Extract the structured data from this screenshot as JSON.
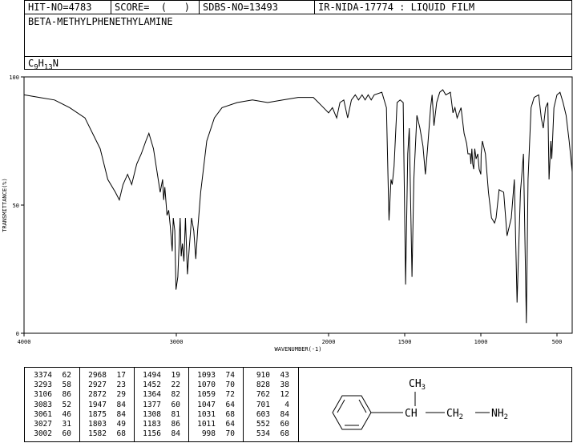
{
  "header": {
    "hit_no": "HIT-NO=4783",
    "score": "SCORE=  (   )",
    "sdbs_no": "SDBS-NO=13493",
    "ir_method": "IR-NIDA-17774 : LIQUID FILM",
    "compound_name": "BETA-METHYLPHENETHYLAMINE",
    "formula": {
      "c": "C",
      "c_n": "9",
      "h": "H",
      "h_n": "13",
      "n": "N"
    }
  },
  "chart_data": {
    "type": "line",
    "xlabel": "WAVENUMBER(-1)",
    "ylabel": "TRANSMITTANCE(%)",
    "xlim": [
      4000,
      400
    ],
    "ylim": [
      0,
      100
    ],
    "x_ticks": [
      4000,
      3000,
      2000,
      1500,
      1000,
      500
    ],
    "y_ticks": [
      100,
      50,
      0
    ],
    "grid": false,
    "x": [
      4000,
      3900,
      3800,
      3700,
      3600,
      3500,
      3450,
      3400,
      3374,
      3350,
      3320,
      3293,
      3260,
      3230,
      3200,
      3180,
      3150,
      3106,
      3090,
      3083,
      3075,
      3061,
      3050,
      3040,
      3027,
      3020,
      3010,
      3002,
      2990,
      2975,
      2968,
      2960,
      2950,
      2940,
      2927,
      2915,
      2900,
      2885,
      2872,
      2860,
      2840,
      2800,
      2750,
      2700,
      2600,
      2500,
      2400,
      2300,
      2200,
      2100,
      2050,
      2000,
      1975,
      1947,
      1925,
      1900,
      1875,
      1850,
      1825,
      1803,
      1780,
      1760,
      1740,
      1720,
      1700,
      1650,
      1620,
      1603,
      1590,
      1582,
      1570,
      1550,
      1530,
      1510,
      1494,
      1480,
      1470,
      1452,
      1440,
      1420,
      1400,
      1380,
      1364,
      1350,
      1330,
      1320,
      1308,
      1290,
      1270,
      1250,
      1230,
      1200,
      1183,
      1170,
      1156,
      1130,
      1110,
      1093,
      1085,
      1070,
      1065,
      1059,
      1053,
      1047,
      1040,
      1031,
      1020,
      1011,
      1000,
      998,
      990,
      970,
      950,
      930,
      910,
      900,
      880,
      850,
      828,
      800,
      780,
      762,
      740,
      720,
      701,
      690,
      670,
      650,
      620,
      603,
      590,
      575,
      560,
      552,
      540,
      534,
      520,
      500,
      480,
      460,
      440,
      420,
      400
    ],
    "y": [
      93,
      92,
      91,
      88,
      84,
      72,
      60,
      55,
      52,
      58,
      62,
      58,
      66,
      70,
      75,
      78,
      72,
      55,
      60,
      52,
      57,
      46,
      48,
      42,
      32,
      45,
      40,
      17,
      22,
      45,
      30,
      35,
      28,
      45,
      23,
      33,
      45,
      40,
      29,
      40,
      55,
      75,
      84,
      88,
      90,
      91,
      90,
      91,
      92,
      92,
      89,
      86,
      88,
      84,
      90,
      91,
      84,
      91,
      93,
      91,
      93,
      91,
      93,
      91,
      93,
      94,
      88,
      44,
      60,
      58,
      65,
      90,
      91,
      90,
      19,
      70,
      80,
      22,
      60,
      85,
      80,
      73,
      62,
      72,
      88,
      93,
      81,
      90,
      94,
      95,
      93,
      94,
      86,
      88,
      84,
      88,
      78,
      74,
      70,
      70,
      66,
      72,
      66,
      64,
      72,
      68,
      70,
      64,
      62,
      70,
      75,
      70,
      55,
      45,
      43,
      45,
      56,
      55,
      38,
      45,
      60,
      12,
      55,
      70,
      4,
      60,
      88,
      92,
      93,
      84,
      80,
      88,
      90,
      60,
      75,
      68,
      88,
      93,
      94,
      90,
      85,
      75,
      63
    ]
  },
  "peak_table": {
    "columns": [
      [
        [
          "3374",
          "62"
        ],
        [
          "3293",
          "58"
        ],
        [
          "3106",
          "86"
        ],
        [
          "3083",
          "52"
        ],
        [
          "3061",
          "46"
        ],
        [
          "3027",
          "31"
        ],
        [
          "3002",
          "60"
        ]
      ],
      [
        [
          "2968",
          "17"
        ],
        [
          "2927",
          "23"
        ],
        [
          "2872",
          "29"
        ],
        [
          "1947",
          "84"
        ],
        [
          "1875",
          "84"
        ],
        [
          "1803",
          "49"
        ],
        [
          "1582",
          "68"
        ]
      ],
      [
        [
          "1494",
          "19"
        ],
        [
          "1452",
          "22"
        ],
        [
          "1364",
          "82"
        ],
        [
          "1377",
          "60"
        ],
        [
          "1308",
          "81"
        ],
        [
          "1183",
          "86"
        ],
        [
          "1156",
          "84"
        ]
      ],
      [
        [
          "1093",
          "74"
        ],
        [
          "1070",
          "70"
        ],
        [
          "1059",
          "72"
        ],
        [
          "1047",
          "64"
        ],
        [
          "1031",
          "68"
        ],
        [
          "1011",
          "64"
        ],
        [
          "998",
          "70"
        ]
      ],
      [
        [
          "910",
          "43"
        ],
        [
          "828",
          "38"
        ],
        [
          "762",
          "12"
        ],
        [
          "701",
          "4"
        ],
        [
          "603",
          "84"
        ],
        [
          "552",
          "60"
        ],
        [
          "534",
          "68"
        ]
      ]
    ]
  },
  "structure": {
    "ch3": "CH",
    "ch3_sub": "3",
    "ch": "CH",
    "ch2": "CH",
    "ch2_sub": "2",
    "nh2": "NH",
    "nh2_sub": "2"
  }
}
